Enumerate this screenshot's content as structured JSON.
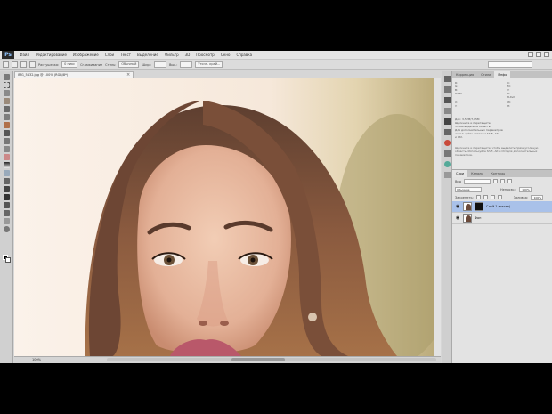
{
  "app": {
    "logo": "Ps",
    "menu": [
      "Файл",
      "Редактирование",
      "Изображение",
      "Слои",
      "Текст",
      "Выделение",
      "Фильтр",
      "3D",
      "Просмотр",
      "Окно",
      "Справка"
    ]
  },
  "options": {
    "controls": [
      "Растушевка:",
      "0 пикс",
      "Сглаживание",
      "Стиль:",
      "Обычный",
      "Шир.:",
      "Выс.:",
      "Уточн. край..."
    ]
  },
  "document": {
    "tab_title": "IMG_5432.jpg @ 100% (RGB/8*)",
    "status": "100%"
  },
  "panels": {
    "top_tabs": [
      "Коррекция",
      "Стили",
      "Инфо"
    ],
    "info_lines": [
      "R:",
      "G:",
      "B:",
      "8-бит",
      "X:",
      "Y:",
      "C:",
      "M:",
      "Y:",
      "K:",
      "8-бит",
      "W:",
      "H:"
    ],
    "doc_lines": [
      "Док: 3,52М/7,05М",
      "Щелкните и перетащите,",
      "чтобы выделить область.",
      "Для дополнительных параметров",
      "используйте клавиши Shift, Alt",
      "и Ctrl."
    ],
    "note": "Щелкните и перетащите, чтобы выделить прямоугольную область. Используйте Shift, Alt и Ctrl для дополнительных параметров."
  },
  "layers_panel": {
    "tabs": [
      "Слои",
      "Каналы",
      "Контуры"
    ],
    "kind_label": "Вид",
    "blend_mode": "Обычные",
    "opacity_label": "Непрозр.:",
    "opacity_value": "100%",
    "lock_label": "Закрепить:",
    "fill_label": "Заливка:",
    "fill_value": "100%",
    "layers": [
      {
        "name": "Слой 1 (маска)",
        "selected": true
      },
      {
        "name": "Фон",
        "selected": false
      }
    ]
  },
  "colors": {
    "accent": "#a9c1e9",
    "panel_bg": "#d6d6d6",
    "canvas_bg": "#f7ede4"
  }
}
